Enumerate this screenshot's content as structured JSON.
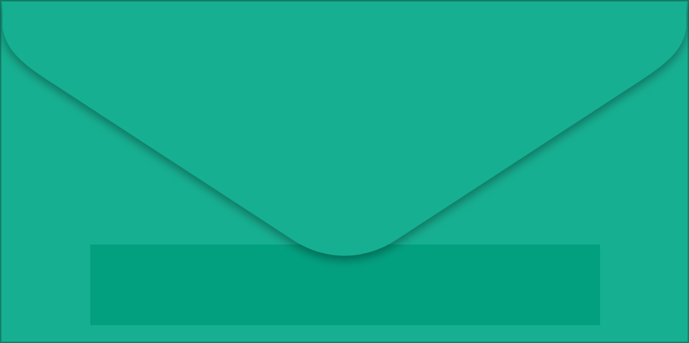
{
  "colors": {
    "envelope_body": "#17af91",
    "envelope_border": "#137f68",
    "flap": "#17af91",
    "flap_shadow": "#0e6f5b",
    "address_panel": "#03a07f",
    "insert_card": "#f7f4f9",
    "pattern_dark": "#141414",
    "pattern_colors": [
      "#e0307a",
      "#2ec4e8",
      "#8fd14f",
      "#f2f2f2",
      "#e85d9c",
      "#1f8fd1"
    ]
  },
  "icons": {
    "envelope": "envelope-icon",
    "flap": "envelope-flap-icon",
    "insert": "card-insert-icon",
    "pattern": "floral-pattern-icon"
  }
}
